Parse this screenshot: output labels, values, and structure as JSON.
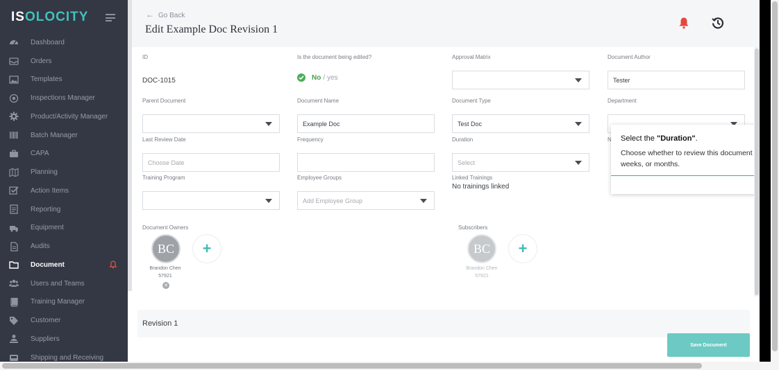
{
  "sidebar": {
    "logo_prefix": "IS",
    "logo_o": "O",
    "logo_suffix": "LOCITY",
    "items": [
      {
        "label": "Dashboard",
        "icon": "dashboard-icon"
      },
      {
        "label": "Orders",
        "icon": "inbox-icon"
      },
      {
        "label": "Templates",
        "icon": "image-icon"
      },
      {
        "label": "Inspections Manager",
        "icon": "target-icon"
      },
      {
        "label": "Product/Activity Manager",
        "icon": "gear-icon"
      },
      {
        "label": "Batch Manager",
        "icon": "barcode-icon"
      },
      {
        "label": "CAPA",
        "icon": "briefcase-icon"
      },
      {
        "label": "Planning",
        "icon": "map-icon"
      },
      {
        "label": "Action Items",
        "icon": "checkbox-icon"
      },
      {
        "label": "Reporting",
        "icon": "report-icon"
      },
      {
        "label": "Equipment",
        "icon": "truck-icon"
      },
      {
        "label": "Audits",
        "icon": "file-icon"
      },
      {
        "label": "Document",
        "icon": "folder-icon"
      },
      {
        "label": "Users and Teams",
        "icon": "users-icon"
      },
      {
        "label": "Training Manager",
        "icon": "book-icon"
      },
      {
        "label": "Customer",
        "icon": "tag-icon"
      },
      {
        "label": "Suppliers",
        "icon": "supplier-icon"
      },
      {
        "label": "Shipping and Receiving",
        "icon": "tray-icon"
      }
    ],
    "active_index": 12
  },
  "header": {
    "go_back": "Go Back",
    "title": "Edit Example Doc Revision 1"
  },
  "form": {
    "id_label": "ID",
    "id_value": "DOC-1015",
    "edited_label": "Is the document being edited?",
    "edited_no": "No",
    "edited_slash": "/",
    "edited_yes": "yes",
    "approval_label": "Approval Matrix",
    "approval_value": "",
    "author_label": "Document Author",
    "author_value": "Tester",
    "parent_label": "Parent Document",
    "parent_value": "",
    "name_label": "Document Name",
    "name_value": "Example Doc",
    "type_label": "Document Type",
    "type_value": "Test Doc",
    "department_label": "Department",
    "department_value": "",
    "last_review_label": "Last Review Date",
    "last_review_placeholder": "Choose Date",
    "frequency_label": "Frequency",
    "frequency_value": "",
    "duration_label": "Duration",
    "duration_placeholder": "Select",
    "hidden_label_initial": "N",
    "training_label": "Training Program",
    "training_value": "",
    "groups_label": "Employee Groups",
    "groups_placeholder": "Add Employee Group",
    "linked_label": "Linked Trainings",
    "linked_value": "No trainings linked"
  },
  "owners": {
    "label": "Document Owners",
    "initials": "BC",
    "name": "Brandon Chen",
    "number": "57921"
  },
  "subscribers": {
    "label": "Subscribers",
    "initials": "BC",
    "name": "Brandon Chen",
    "number": "57921"
  },
  "revision": {
    "title": "Revision 1"
  },
  "save_label": "Save Document",
  "tooltip": {
    "title_prefix": "Select the ",
    "title_bold": "\"Duration\"",
    "title_suffix": ".",
    "body": "Choose whether to review this document in weeks, or months."
  },
  "colors": {
    "sidebar_bg": "#343844",
    "accent_teal": "#41c1bc",
    "alert_red": "#e4483d",
    "success_green": "#4cae5a",
    "save_button": "#6cc9c3"
  }
}
